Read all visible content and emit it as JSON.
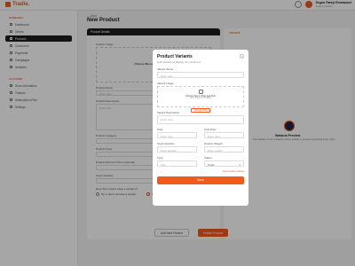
{
  "app": {
    "logo_text": "Tradie."
  },
  "user": {
    "name": "Segun Faniyi Emmanuel",
    "role": "System Admin"
  },
  "sidebar": {
    "general_title": "GENERAL",
    "general_items": [
      {
        "label": "Dashboard"
      },
      {
        "label": "Orders"
      },
      {
        "label": "Products"
      },
      {
        "label": "Customers"
      },
      {
        "label": "Payments"
      },
      {
        "label": "Campaigns"
      },
      {
        "label": "Analytics"
      }
    ],
    "active_index": 2,
    "actions_title": "ACTIONS",
    "actions_items": [
      {
        "label": "Store Information"
      },
      {
        "label": "Themes"
      },
      {
        "label": "Subscription Plan"
      },
      {
        "label": "Settings"
      }
    ]
  },
  "main": {
    "back_label": "← Back",
    "page_title": "New Product",
    "details_header": "Product Details",
    "product_image_label": "Product Image",
    "upload_text": "Choose files or drag and drop",
    "product_name_label": "Product Name",
    "product_name_placeholder": "Enter here",
    "product_description_label": "Product Description",
    "product_description_placeholder": "Enter here",
    "product_category_label": "Product Category",
    "product_price_label": "Product Price",
    "product_discount_label": "Product Discount Price (optional)",
    "stock_quantity_label": "Stock Quantity",
    "variation_question": "Does this product have a variation?",
    "radio_no": "No, it does not have a variant",
    "radio_yes": "Yes, it has variants",
    "variants_title": "Variants",
    "preview_title": "Variants Preview",
    "preview_sub": "View details of your variants before adding to ensure everything looks right.",
    "add_new_label": "Add New Product",
    "publish_label": "Publish Product"
  },
  "modal": {
    "title": "Product Variants",
    "subtitle": "Add variants to display for customers",
    "variant_name_label": "Variant Name",
    "variant_name_placeholder": "Enter here",
    "variant_image_label": "Variant Image",
    "upload_line": "Choose files or drag and drop",
    "upload_hint": "JPG, PNG up to 10MB",
    "upload_button": "Upload Files",
    "variant_description_label": "Variant Description",
    "variant_description_placeholder": "Enter here",
    "price_label": "Price",
    "price_placeholder": "Enter here",
    "cost_price_label": "Cost Price",
    "cost_price_placeholder": "Enter here",
    "stock_quantity_label": "Stock Quantity",
    "stock_quantity_placeholder": "Enter quantity",
    "product_weight_label": "Product Weight",
    "product_weight_placeholder": "Enter weight",
    "type_label": "Type",
    "type_value": "Size",
    "status_label": "Status",
    "status_value": "Small",
    "add_another": "Add another variant",
    "save_label": "Save"
  },
  "colors": {
    "accent": "#f05a1a",
    "dark": "#1e1e22"
  }
}
